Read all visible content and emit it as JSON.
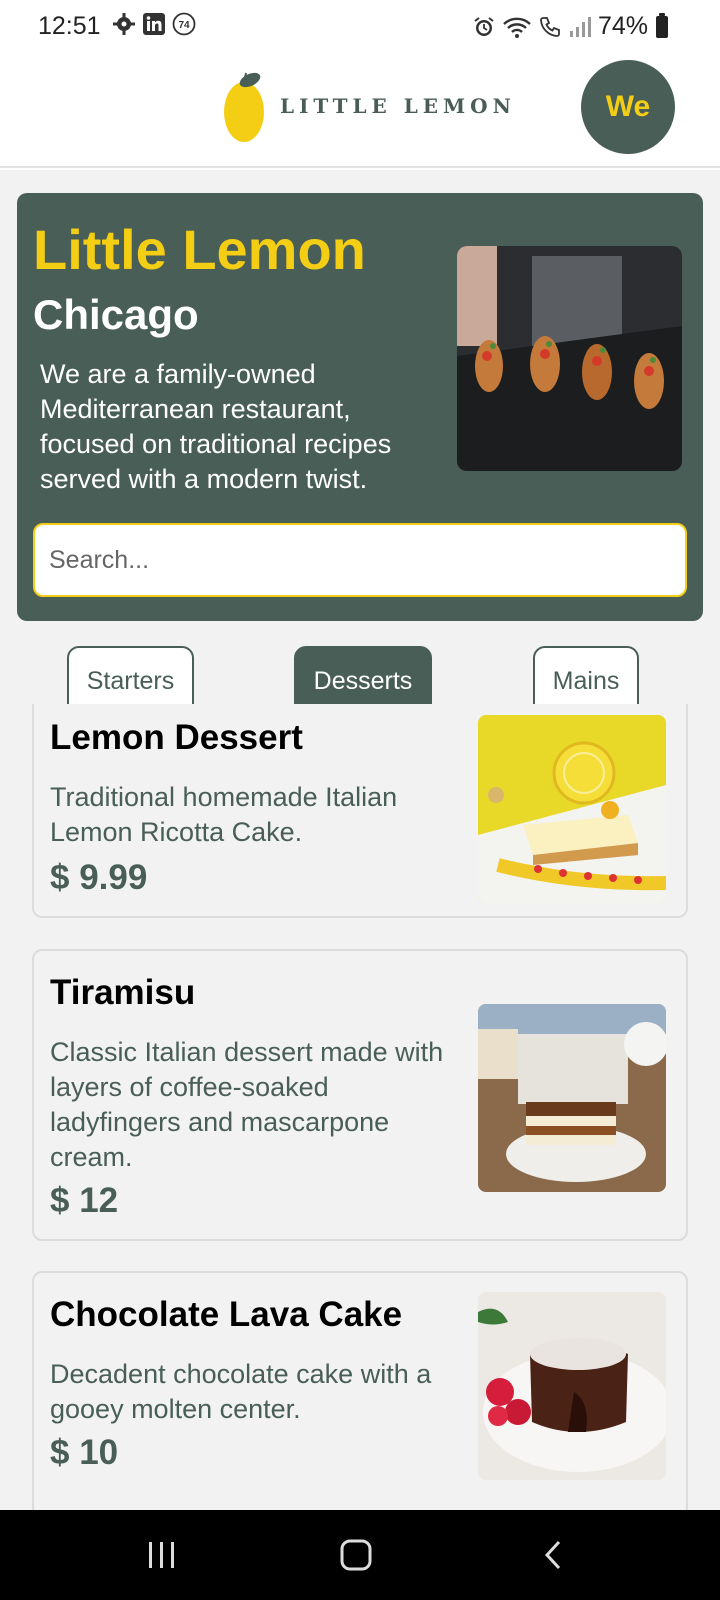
{
  "status_bar": {
    "time": "12:51",
    "battery": "74%",
    "notification_badge": "74"
  },
  "header": {
    "logo_text": "LITTLE LEMON",
    "avatar_initials": "We"
  },
  "hero": {
    "title": "Little Lemon",
    "subtitle": "Chicago",
    "description": "We are a family-owned Mediterranean restaurant, focused on traditional recipes served with a modern twist.",
    "search_placeholder": "Search..."
  },
  "categories": [
    {
      "label": "Starters",
      "active": false
    },
    {
      "label": "Desserts",
      "active": true
    },
    {
      "label": "Mains",
      "active": false
    }
  ],
  "menu_items": [
    {
      "name": "Lemon Dessert",
      "description": "Traditional homemade Italian Lemon Ricotta Cake.",
      "price": "$ 9.99"
    },
    {
      "name": "Tiramisu",
      "description": "Classic Italian dessert made with layers of coffee-soaked ladyfingers and mascarpone cream.",
      "price": "$ 12"
    },
    {
      "name": "Chocolate Lava Cake",
      "description": "Decadent chocolate cake with a gooey molten center.",
      "price": "$ 10"
    }
  ],
  "colors": {
    "primary_green": "#495e57",
    "primary_yellow": "#f4ce14",
    "background": "#f2f2f2"
  }
}
